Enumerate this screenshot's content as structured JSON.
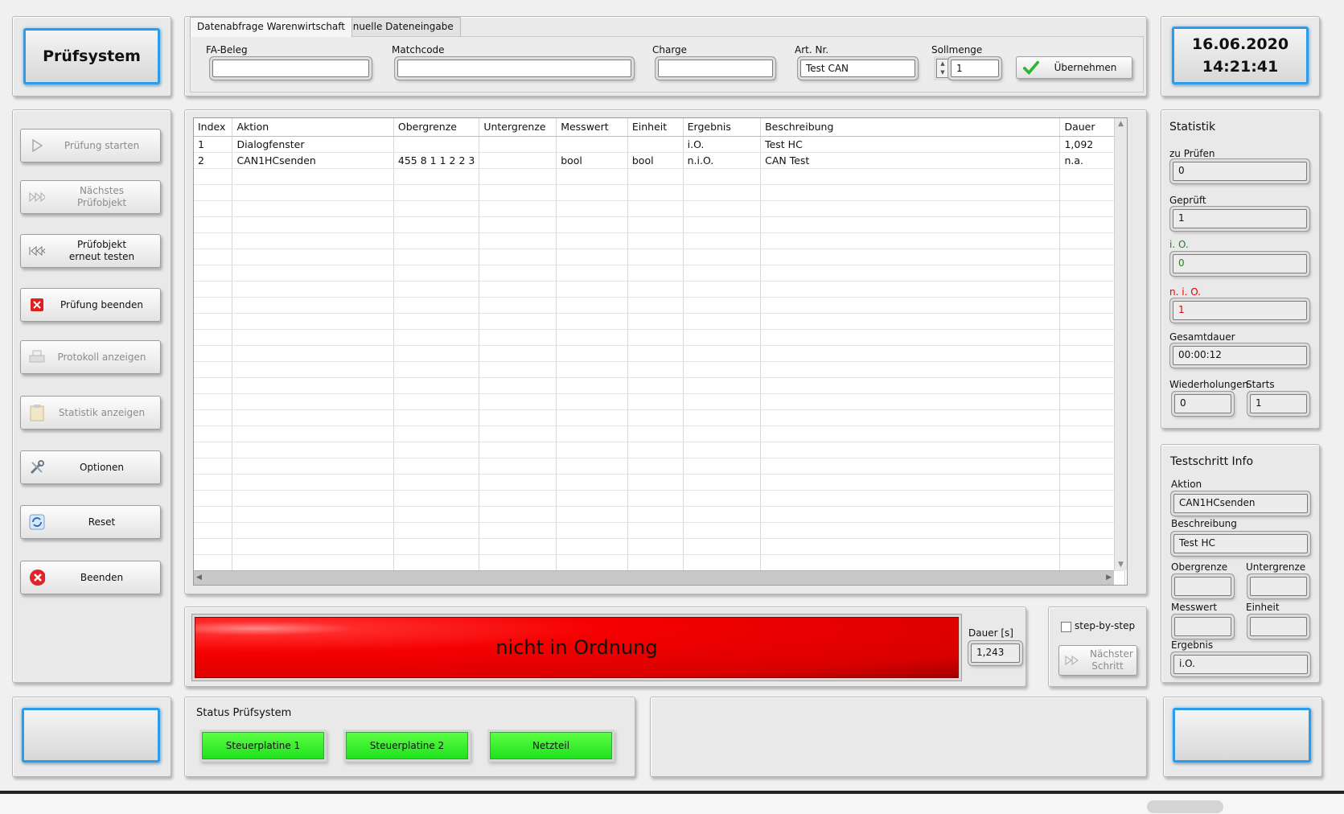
{
  "app": {
    "title": "Prüfsystem",
    "date": "16.06.2020",
    "time": "14:21:41"
  },
  "tabs": [
    {
      "label": "Datenabfrage Warenwirtschaft"
    },
    {
      "label": "Manuelle Dateneingabe"
    }
  ],
  "header_form": {
    "fa_beleg": {
      "label": "FA-Beleg",
      "value": ""
    },
    "matchcode": {
      "label": "Matchcode",
      "value": ""
    },
    "charge": {
      "label": "Charge",
      "value": ""
    },
    "art_nr": {
      "label": "Art. Nr.",
      "value": "Test CAN"
    },
    "sollmenge": {
      "label": "Sollmenge",
      "value": "1"
    },
    "uebernehmen_label": "Übernehmen"
  },
  "sidebar": {
    "buttons": [
      {
        "label": "Prüfung starten",
        "icon": "play-icon",
        "enabled": false
      },
      {
        "label": "Nächstes Prüfobjekt",
        "icon": "skip-forward-icon",
        "enabled": false
      },
      {
        "label": "Prüfobjekt erneut testen",
        "icon": "skip-back-icon",
        "enabled": true
      },
      {
        "label": "Prüfung beenden",
        "icon": "red-x-icon",
        "enabled": true
      },
      {
        "label": "Protokoll anzeigen",
        "icon": "printer-icon",
        "enabled": false
      },
      {
        "label": "Statistik anzeigen",
        "icon": "clipboard-icon",
        "enabled": false
      },
      {
        "label": "Optionen",
        "icon": "tools-icon",
        "enabled": true
      },
      {
        "label": "Reset",
        "icon": "refresh-icon",
        "enabled": true
      },
      {
        "label": "Beenden",
        "icon": "red-circle-x-icon",
        "enabled": true
      }
    ]
  },
  "table": {
    "columns": [
      "Index",
      "Aktion",
      "Obergrenze",
      "Untergrenze",
      "Messwert",
      "Einheit",
      "Ergebnis",
      "Beschreibung",
      "Dauer"
    ],
    "rows": [
      [
        "1",
        "Dialogfenster",
        "",
        "",
        "",
        "",
        "i.O.",
        "Test HC",
        "1,092"
      ],
      [
        "2",
        "CAN1HCsenden",
        "455 8 1 1 2 2 3",
        "",
        "bool",
        "bool",
        "n.i.O.",
        "CAN Test",
        "n.a."
      ]
    ],
    "empty_rows": 26
  },
  "result": {
    "text": "nicht in Ordnung",
    "color": "#f00000",
    "dauer_label": "Dauer [s]",
    "dauer_value": "1,243"
  },
  "step": {
    "checkbox_label": "step-by-step",
    "next_label": "Nächster Schritt"
  },
  "statistik": {
    "title": "Statistik",
    "zu_pruefen": {
      "label": "zu Prüfen",
      "value": "0"
    },
    "geprueft": {
      "label": "Geprüft",
      "value": "1"
    },
    "io": {
      "label": "i. O.",
      "value": "0",
      "color": "#2a7a2a"
    },
    "nio": {
      "label": "n. i. O.",
      "value": "1",
      "color": "#e00000"
    },
    "gesamtdauer": {
      "label": "Gesamtdauer",
      "value": "00:00:12"
    },
    "wiederholungen": {
      "label": "Wiederholungen",
      "value": "0"
    },
    "starts": {
      "label": "Starts",
      "value": "1"
    }
  },
  "testschritt": {
    "title": "Testschritt Info",
    "aktion": {
      "label": "Aktion",
      "value": "CAN1HCsenden"
    },
    "beschreibung": {
      "label": "Beschreibung",
      "value": "Test HC"
    },
    "obergrenze": {
      "label": "Obergrenze",
      "value": ""
    },
    "untergrenze": {
      "label": "Untergrenze",
      "value": ""
    },
    "messwert": {
      "label": "Messwert",
      "value": ""
    },
    "einheit": {
      "label": "Einheit",
      "value": ""
    },
    "ergebnis": {
      "label": "Ergebnis",
      "value": "i.O."
    }
  },
  "status": {
    "title": "Status Prüfsystem",
    "items": [
      {
        "label": "Steuerplatine 1",
        "color": "#33ee22"
      },
      {
        "label": "Steuerplatine 2",
        "color": "#33ee22"
      },
      {
        "label": "Netzteil",
        "color": "#33ee22"
      }
    ]
  }
}
